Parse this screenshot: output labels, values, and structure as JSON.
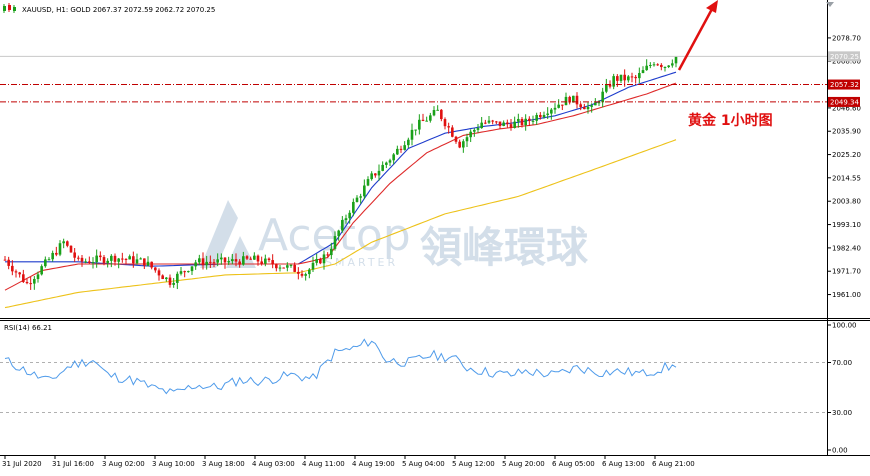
{
  "header": {
    "symbol_info": "XAUUSD, H1:  GOLD  2067.37 2072.59 2062.72 2070.25"
  },
  "rsi_header": "RSI(14) 66.21",
  "annotation": "黄金 1小时图",
  "watermark": {
    "brand": "Acetop",
    "brand_cn": "領峰環球",
    "sub": "SMARTER"
  },
  "colors": {
    "bull": "#19A019",
    "bear": "#E01010",
    "ma_fast": "#1E3CCC",
    "ma_mid": "#DE2A2A",
    "ma_slow": "#EDC21A",
    "rsi": "#4F9BEA",
    "level": "#C00000",
    "arrow": "#E01010"
  },
  "chart_data": [
    {
      "type": "candlestick",
      "title": "XAUUSD, H1",
      "ylim": [
        1953,
        2086
      ],
      "y_ticks": [
        "2078.70",
        "2068.00",
        "2057.32",
        "2049.34",
        "2046.60",
        "2035.90",
        "2025.20",
        "2014.55",
        "2003.80",
        "1993.10",
        "1982.40",
        "1971.70",
        "1961.00"
      ],
      "price_tags": [
        {
          "label": "2070.25",
          "value": 2070.25,
          "style": "current"
        },
        {
          "label": "2057.32",
          "value": 2057.32,
          "style": "level"
        },
        {
          "label": "2049.34",
          "value": 2049.34,
          "style": "level"
        }
      ],
      "x_labels": [
        "31 Jul 2020",
        "31 Jul 16:00",
        "3 Aug 02:00",
        "3 Aug 10:00",
        "3 Aug 18:00",
        "4 Aug 03:00",
        "4 Aug 11:00",
        "4 Aug 19:00",
        "5 Aug 04:00",
        "5 Aug 12:00",
        "5 Aug 20:00",
        "6 Aug 05:00",
        "6 Aug 13:00",
        "6 Aug 21:00"
      ],
      "anchors": [
        [
          0,
          1977
        ],
        [
          6,
          1966
        ],
        [
          12,
          1977
        ],
        [
          16,
          1985
        ],
        [
          20,
          1976
        ],
        [
          30,
          1978
        ],
        [
          38,
          1976
        ],
        [
          45,
          1967
        ],
        [
          52,
          1976
        ],
        [
          60,
          1976
        ],
        [
          68,
          1977
        ],
        [
          76,
          1974
        ],
        [
          82,
          1971
        ],
        [
          88,
          1980
        ],
        [
          94,
          2000
        ],
        [
          100,
          2015
        ],
        [
          106,
          2025
        ],
        [
          112,
          2038
        ],
        [
          118,
          2045
        ],
        [
          124,
          2030
        ],
        [
          130,
          2040
        ],
        [
          136,
          2039
        ],
        [
          142,
          2040
        ],
        [
          148,
          2046
        ],
        [
          154,
          2051
        ],
        [
          160,
          2046
        ],
        [
          166,
          2060
        ],
        [
          172,
          2060
        ],
        [
          177,
          2068
        ],
        [
          180,
          2066
        ],
        [
          183,
          2070
        ]
      ],
      "series": [
        {
          "name": "MA fast",
          "anchors": [
            [
              0,
              1976
            ],
            [
              20,
              1976
            ],
            [
              40,
              1974
            ],
            [
              60,
              1975
            ],
            [
              80,
              1975
            ],
            [
              90,
              1985
            ],
            [
              100,
              2010
            ],
            [
              110,
              2028
            ],
            [
              120,
              2035
            ],
            [
              130,
              2038
            ],
            [
              140,
              2040
            ],
            [
              150,
              2043
            ],
            [
              160,
              2048
            ],
            [
              170,
              2056
            ],
            [
              183,
              2063
            ]
          ]
        },
        {
          "name": "MA mid",
          "anchors": [
            [
              0,
              1963
            ],
            [
              10,
              1972
            ],
            [
              20,
              1975
            ],
            [
              40,
              1975
            ],
            [
              60,
              1975
            ],
            [
              80,
              1975
            ],
            [
              88,
              1978
            ],
            [
              95,
              1994
            ],
            [
              105,
              2012
            ],
            [
              115,
              2026
            ],
            [
              125,
              2034
            ],
            [
              135,
              2037
            ],
            [
              145,
              2039
            ],
            [
              155,
              2043
            ],
            [
              165,
              2048
            ],
            [
              175,
              2053
            ],
            [
              183,
              2058
            ]
          ]
        },
        {
          "name": "MA slow",
          "anchors": [
            [
              0,
              1955
            ],
            [
              20,
              1962
            ],
            [
              40,
              1966
            ],
            [
              60,
              1970
            ],
            [
              80,
              1971
            ],
            [
              90,
              1975
            ],
            [
              100,
              1985
            ],
            [
              120,
              1998
            ],
            [
              140,
              2006
            ],
            [
              160,
              2018
            ],
            [
              183,
              2032
            ]
          ]
        }
      ],
      "horizontal_levels": [
        2057.32,
        2049.34
      ]
    },
    {
      "type": "line",
      "title": "RSI(14)",
      "ylim": [
        0,
        100
      ],
      "y_ticks": [
        "100.00",
        "70.00",
        "30.00",
        "0.00"
      ],
      "dashed_levels": [
        70,
        30
      ],
      "values": [
        [
          0,
          72
        ],
        [
          8,
          60
        ],
        [
          12,
          55
        ],
        [
          18,
          68
        ],
        [
          24,
          72
        ],
        [
          28,
          60
        ],
        [
          36,
          55
        ],
        [
          40,
          50
        ],
        [
          46,
          45
        ],
        [
          52,
          52
        ],
        [
          58,
          50
        ],
        [
          64,
          56
        ],
        [
          70,
          55
        ],
        [
          78,
          60
        ],
        [
          84,
          57
        ],
        [
          90,
          78
        ],
        [
          96,
          82
        ],
        [
          100,
          88
        ],
        [
          104,
          72
        ],
        [
          110,
          70
        ],
        [
          116,
          76
        ],
        [
          122,
          74
        ],
        [
          126,
          66
        ],
        [
          132,
          62
        ],
        [
          138,
          60
        ],
        [
          142,
          63
        ],
        [
          150,
          60
        ],
        [
          156,
          66
        ],
        [
          162,
          62
        ],
        [
          168,
          63
        ],
        [
          174,
          61
        ],
        [
          180,
          66
        ],
        [
          183,
          66.21
        ]
      ]
    }
  ]
}
